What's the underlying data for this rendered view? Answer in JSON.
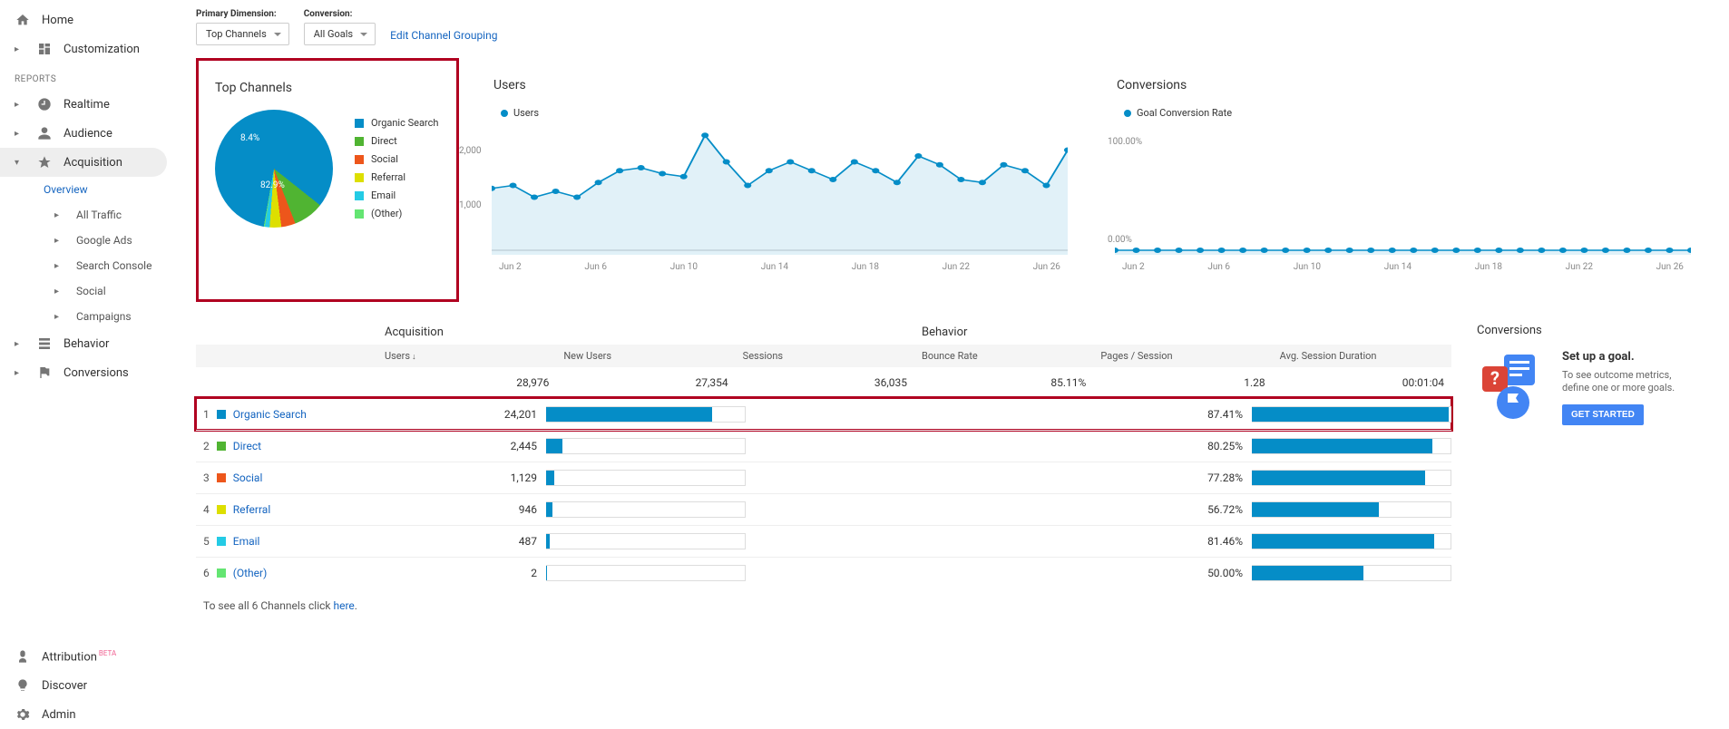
{
  "nav": {
    "home": "Home",
    "customization": "Customization",
    "reports_heading": "REPORTS",
    "realtime": "Realtime",
    "audience": "Audience",
    "acquisition": "Acquisition",
    "overview": "Overview",
    "all_traffic": "All Traffic",
    "google_ads": "Google Ads",
    "search_console": "Search Console",
    "social": "Social",
    "campaigns": "Campaigns",
    "behavior": "Behavior",
    "conversions": "Conversions",
    "attribution": "Attribution",
    "attribution_badge": "BETA",
    "discover": "Discover",
    "admin": "Admin"
  },
  "controls": {
    "primary_dim_label": "Primary Dimension:",
    "conversion_label": "Conversion:",
    "top_channels_btn": "Top Channels",
    "all_goals_btn": "All Goals",
    "edit_grouping": "Edit Channel Grouping"
  },
  "pie_card": {
    "title": "Top Channels"
  },
  "users_card": {
    "title": "Users",
    "legend": "Users"
  },
  "conv_card": {
    "title": "Conversions",
    "legend": "Goal Conversion Rate",
    "y_top": "100.00%",
    "y_bottom": "0.00%"
  },
  "x_ticks": [
    "Jun 2",
    "Jun 6",
    "Jun 10",
    "Jun 14",
    "Jun 18",
    "Jun 22",
    "Jun 26"
  ],
  "users_y": [
    "2,000",
    "1,000"
  ],
  "table": {
    "group_acq": "Acquisition",
    "group_beh": "Behavior",
    "col_users": "Users",
    "col_new": "New Users",
    "col_sess": "Sessions",
    "col_bounce": "Bounce Rate",
    "col_pps": "Pages / Session",
    "col_asd": "Avg. Session Duration",
    "tot_users": "28,976",
    "tot_new": "27,354",
    "tot_sess": "36,035",
    "tot_bounce": "85.11%",
    "tot_pps": "1.28",
    "tot_asd": "00:01:04",
    "footer_pre": "To see all 6 Channels click ",
    "footer_link": "here"
  },
  "rows": [
    {
      "n": "1",
      "name": "Organic Search",
      "users": "24,201",
      "bounce": "87.41%",
      "users_pct": 83.5,
      "bounce_pct": 99,
      "color": "#058dc7"
    },
    {
      "n": "2",
      "name": "Direct",
      "users": "2,445",
      "bounce": "80.25%",
      "users_pct": 8.4,
      "bounce_pct": 91,
      "color": "#50b432"
    },
    {
      "n": "3",
      "name": "Social",
      "users": "1,129",
      "bounce": "77.28%",
      "users_pct": 3.9,
      "bounce_pct": 87,
      "color": "#ed561b"
    },
    {
      "n": "4",
      "name": "Referral",
      "users": "946",
      "bounce": "56.72%",
      "users_pct": 3.3,
      "bounce_pct": 64,
      "color": "#dddf00"
    },
    {
      "n": "5",
      "name": "Email",
      "users": "487",
      "bounce": "81.46%",
      "users_pct": 1.7,
      "bounce_pct": 92,
      "color": "#24cbe5"
    },
    {
      "n": "6",
      "name": "(Other)",
      "users": "2",
      "bounce": "50.00%",
      "users_pct": 0.3,
      "bounce_pct": 56,
      "color": "#64e572"
    }
  ],
  "conv_panel": {
    "title": "Conversions",
    "heading": "Set up a goal.",
    "desc": "To see outcome metrics, define one or more goals.",
    "cta": "GET STARTED"
  },
  "chart_data": [
    {
      "type": "pie",
      "title": "Top Channels",
      "series": [
        {
          "name": "Organic Search",
          "value": 82.9,
          "color": "#058dc7"
        },
        {
          "name": "Direct",
          "value": 8.4,
          "color": "#50b432"
        },
        {
          "name": "Social",
          "value": 3.9,
          "color": "#ed561b"
        },
        {
          "name": "Referral",
          "value": 3.2,
          "color": "#dddf00"
        },
        {
          "name": "Email",
          "value": 1.3,
          "color": "#24cbe5"
        },
        {
          "name": "(Other)",
          "value": 0.3,
          "color": "#64e572"
        }
      ],
      "labels_on_chart": [
        "82.9%",
        "8.4%"
      ]
    },
    {
      "type": "line",
      "title": "Users",
      "xlabel": "",
      "ylabel": "",
      "ylim": [
        0,
        2000
      ],
      "series": [
        {
          "name": "Users",
          "color": "#058dc7",
          "values": [
            1050,
            1100,
            900,
            1000,
            900,
            1150,
            1350,
            1400,
            1300,
            1250,
            1950,
            1500,
            1100,
            1350,
            1500,
            1350,
            1200,
            1500,
            1350,
            1150,
            1600,
            1450,
            1200,
            1150,
            1450,
            1350,
            1100,
            1700
          ]
        }
      ],
      "x_ticks": [
        "Jun 2",
        "Jun 6",
        "Jun 10",
        "Jun 14",
        "Jun 18",
        "Jun 22",
        "Jun 26"
      ]
    },
    {
      "type": "line",
      "title": "Conversions",
      "xlabel": "",
      "ylabel": "",
      "ylim": [
        0,
        100
      ],
      "series": [
        {
          "name": "Goal Conversion Rate",
          "color": "#058dc7",
          "values": [
            0,
            0,
            0,
            0,
            0,
            0,
            0,
            0,
            0,
            0,
            0,
            0,
            0,
            0,
            0,
            0,
            0,
            0,
            0,
            0,
            0,
            0,
            0,
            0,
            0,
            0,
            0,
            0
          ]
        }
      ],
      "x_ticks": [
        "Jun 2",
        "Jun 6",
        "Jun 10",
        "Jun 14",
        "Jun 18",
        "Jun 22",
        "Jun 26"
      ]
    }
  ]
}
